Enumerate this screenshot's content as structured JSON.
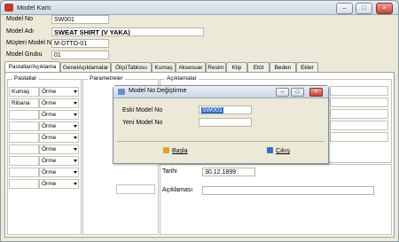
{
  "window": {
    "title": "Model Kartı"
  },
  "window_buttons": {
    "minimize": "–",
    "maximize": "□",
    "close": "×"
  },
  "form": {
    "model_no_label": "Model No",
    "model_no_value": "SW001",
    "model_adi_label": "Model Adı",
    "model_adi_value": "SWEAT SHIRT (V YAKA)",
    "musteri_label": "Müşteri Model No",
    "musteri_value": "M-DTTO-01",
    "grup_label": "Model Grubu",
    "grup_value": "01"
  },
  "tabs": [
    "Pastallar/Açıklama",
    "GenelAçıklamalar",
    "ÖlçüTablosu",
    "Kumaş",
    "Aksesuar",
    "Resim",
    "Klip",
    "Etüt",
    "Beden",
    "Ekler"
  ],
  "panel": {
    "pastallar_title": "Pastallar",
    "parametreler_title": "Parametreler",
    "aciklamalar_title": "Açıklamalar",
    "rows": [
      {
        "name": "Kumaş",
        "type": "Örme"
      },
      {
        "name": "Ribana",
        "type": "Örme"
      },
      {
        "name": "",
        "type": "Örme"
      },
      {
        "name": "",
        "type": "Örme"
      },
      {
        "name": "",
        "type": "Örme"
      },
      {
        "name": "",
        "type": "Örme"
      },
      {
        "name": "",
        "type": "Örme"
      },
      {
        "name": "",
        "type": "Örme"
      },
      {
        "name": "",
        "type": "Örme"
      }
    ],
    "tarih_label": "Tarihi",
    "tarih_value": "30.12.1899",
    "aciklamasi_label": "Açıklaması"
  },
  "dialog": {
    "title": "Model No Değiştirme",
    "eski_label": "Eski Model No",
    "eski_value": "SW001",
    "yeni_label": "Yeni Model No",
    "yeni_value": "",
    "basla_label": "Başla",
    "cikis_label": "Çıkış"
  }
}
